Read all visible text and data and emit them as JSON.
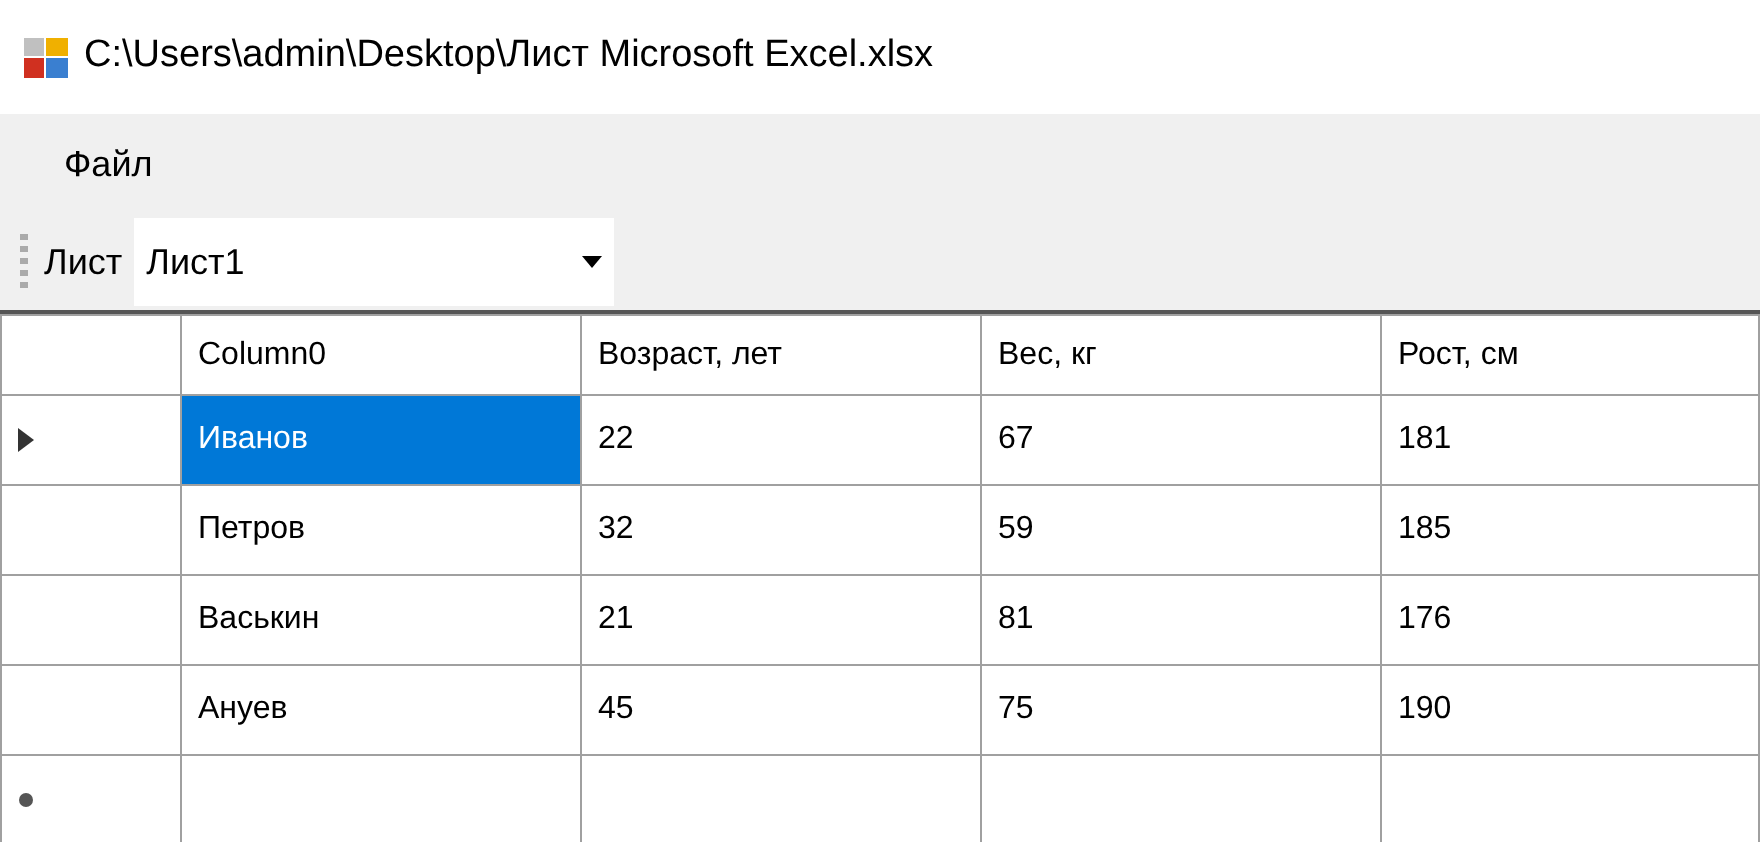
{
  "window": {
    "title": "C:\\Users\\admin\\Desktop\\Лист Microsoft Excel.xlsx"
  },
  "menu": [
    {
      "label": "Файл"
    }
  ],
  "toolbar": {
    "label": "Лист",
    "sheet_select": {
      "value": "Лист1"
    }
  },
  "grid": {
    "columns": [
      "Column0",
      "Возраст, лет",
      "Вес, кг",
      "Рост, см"
    ],
    "rows": [
      {
        "kind": "data",
        "current": true,
        "cells": [
          {
            "text": "Иванов",
            "selected": true
          },
          {
            "text": "22",
            "selected": false
          },
          {
            "text": "67",
            "selected": false
          },
          {
            "text": "181",
            "selected": false
          }
        ]
      },
      {
        "kind": "data",
        "current": false,
        "cells": [
          {
            "text": "Петров",
            "selected": false
          },
          {
            "text": "32",
            "selected": false
          },
          {
            "text": "59",
            "selected": false
          },
          {
            "text": "185",
            "selected": false
          }
        ]
      },
      {
        "kind": "data",
        "current": false,
        "cells": [
          {
            "text": "Васькин",
            "selected": false
          },
          {
            "text": "21",
            "selected": false
          },
          {
            "text": "81",
            "selected": false
          },
          {
            "text": "176",
            "selected": false
          }
        ]
      },
      {
        "kind": "data",
        "current": false,
        "cells": [
          {
            "text": "Ануев",
            "selected": false
          },
          {
            "text": "45",
            "selected": false
          },
          {
            "text": "75",
            "selected": false
          },
          {
            "text": "190",
            "selected": false
          }
        ]
      },
      {
        "kind": "new"
      }
    ]
  }
}
